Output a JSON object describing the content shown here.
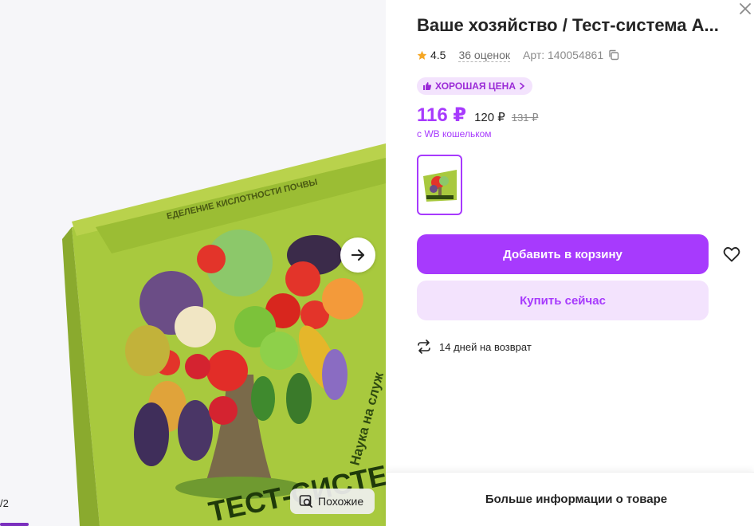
{
  "product": {
    "title": "Ваше хозяйство / Тест-система А...",
    "rating": "4.5",
    "reviews": "36 оценок",
    "article": "Арт: 140054861"
  },
  "badge": {
    "label": "ХОРОШАЯ ЦЕНА"
  },
  "price": {
    "wallet": "116 ₽",
    "regular": "120 ₽",
    "old": "131 ₽",
    "wallet_note": "с WB кошельком"
  },
  "actions": {
    "add_to_cart": "Добавить в корзину",
    "buy_now": "Купить сейчас"
  },
  "delivery": {
    "return_policy": "14 дней на возврат"
  },
  "gallery": {
    "similar_label": "Похожие",
    "counter": "/2",
    "box_text_top": "ЕДЕЛЕНИЕ КИСЛОТНОСТИ ПОЧВЫ",
    "box_text_side": "Наука на служ",
    "box_text_bottom": "ТЕСТ-СИСТЕМА"
  },
  "footer": {
    "more_info": "Больше информации о товаре"
  },
  "colors": {
    "accent": "#a73afd",
    "accent_light": "#f3e3fd",
    "star": "#f5a623",
    "box_green": "#9bc23a"
  },
  "icons": [
    "star-icon",
    "copy-icon",
    "thumbs-up-icon",
    "chevron-right-icon",
    "arrow-right-icon",
    "search-image-icon",
    "heart-icon",
    "return-arrows-icon",
    "close-icon"
  ]
}
